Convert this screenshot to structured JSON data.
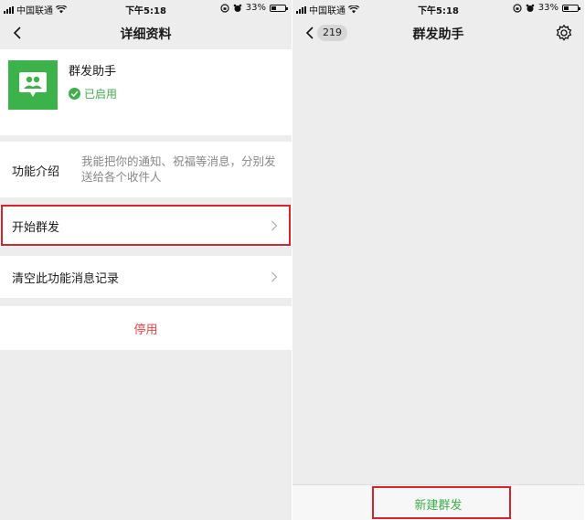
{
  "status": {
    "carrier": "中国联通",
    "time": "下午5:18",
    "battery": "33%",
    "battery_level": 0.33
  },
  "left": {
    "nav_title": "详细资料",
    "profile": {
      "name": "群发助手",
      "status": "已启用"
    },
    "intro": {
      "label": "功能介绍",
      "text": "我能把你的通知、祝福等消息，分别发送给各个收件人"
    },
    "start_label": "开始群发",
    "clear_label": "清空此功能消息记录",
    "disable_label": "停用"
  },
  "right": {
    "nav_title": "群发助手",
    "unread_count": "219",
    "new_button": "新建群发"
  },
  "icons": [
    "signal-icon",
    "wifi-icon",
    "lock-rotation-icon",
    "alarm-icon",
    "battery-icon",
    "back-chevron-icon",
    "chevron-right-icon",
    "settings-gear-icon",
    "check-circle-icon",
    "broadcast-people-icon"
  ],
  "colors": {
    "accent_green": "#3fae4b",
    "danger_red": "#e64340",
    "highlight": "#d9232b"
  }
}
